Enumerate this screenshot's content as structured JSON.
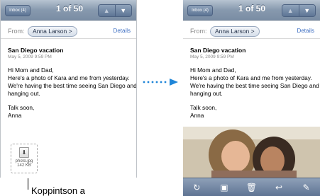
{
  "left_screen": {
    "nav": {
      "inbox_label": "Inbox (4)",
      "counter": "1 of 50",
      "up_icon": "up-arrow-icon",
      "down_icon": "down-arrow-icon"
    },
    "header": {
      "from_label": "From:",
      "sender": "Anna Larson",
      "sender_chevron": ">",
      "details_label": "Details"
    },
    "message": {
      "subject": "San Diego vacation",
      "date": "May 5, 2009 9:59 PM",
      "greeting": "Hi Mom and Dad,",
      "body": "Here's a photo of Kara and me from yesterday. We're having the best time seeing San Diego and hanging out.",
      "signoff": "Talk soon,",
      "signature": "Anna"
    },
    "attachment": {
      "icon": "download-arrow-icon",
      "name": "photo.jpg",
      "size": "142 KB"
    }
  },
  "right_screen": {
    "nav": {
      "inbox_label": "Inbox (4)",
      "counter": "1 of 50"
    },
    "header": {
      "from_label": "From:",
      "sender": "Anna Larson",
      "sender_chevron": ">",
      "details_label": "Details"
    },
    "message": {
      "subject": "San Diego vacation",
      "date": "May 5, 2009 9:59 PM",
      "greeting": "Hi Mom and Dad,",
      "body": "Here's a photo of Kara and me from yesterday. We're having the best time seeing San Diego and hanging out.",
      "signoff": "Talk soon,",
      "signature": "Anna"
    },
    "toolbar": [
      "refresh-icon",
      "move-folder-icon",
      "trash-icon",
      "reply-icon",
      "compose-icon"
    ]
  },
  "callout": {
    "text": "Koppintson a"
  },
  "colors": {
    "nav_bar": "#8799ae",
    "link": "#3d6ec2",
    "arrow": "#1f86d8"
  }
}
